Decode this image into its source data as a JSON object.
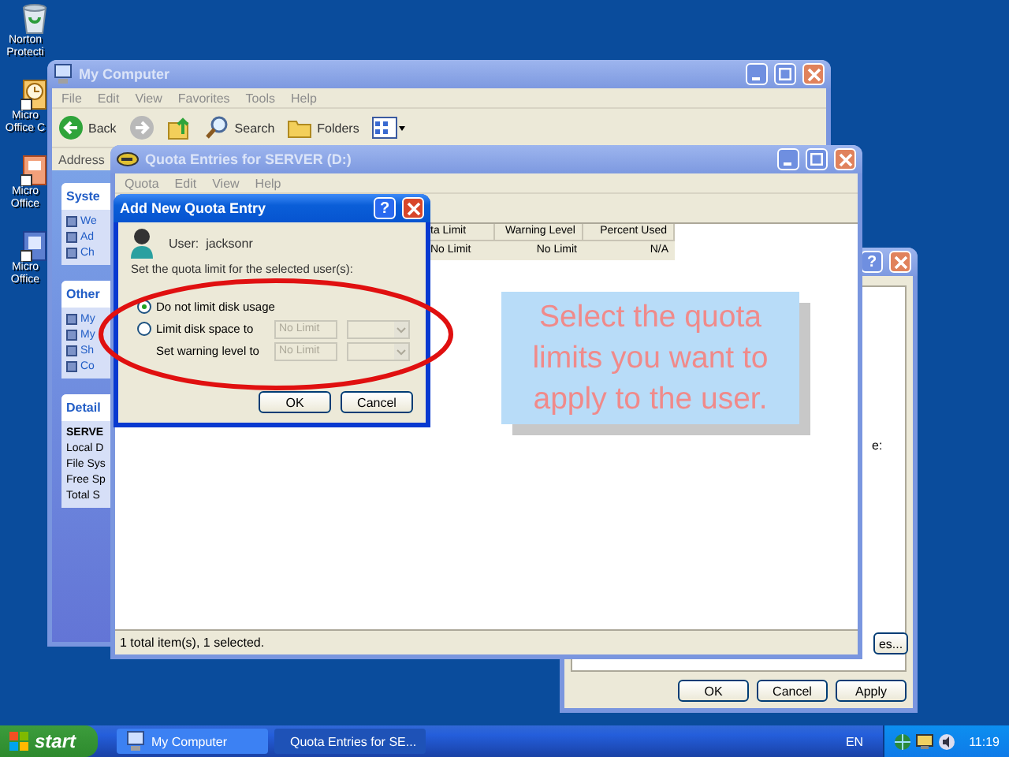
{
  "desktop_icons": [
    {
      "kind": "bin",
      "lines": [
        "Norton",
        "Protecti"
      ]
    },
    {
      "kind": "clock",
      "lines": [
        "Micro",
        "Office C"
      ]
    },
    {
      "kind": "slides",
      "lines": [
        "Micro",
        "Office"
      ]
    },
    {
      "kind": "doc",
      "lines": [
        "Micro",
        "Office"
      ]
    }
  ],
  "my_computer": {
    "title": "My Computer",
    "active": false,
    "menu": [
      "File",
      "Edit",
      "View",
      "Favorites",
      "Tools",
      "Help"
    ],
    "toolbar": [
      {
        "kind": "back",
        "label": "Back"
      },
      {
        "kind": "forward"
      },
      {
        "kind": "up"
      },
      {
        "kind": "search",
        "label": "Search"
      },
      {
        "kind": "folders",
        "label": "Folders"
      },
      {
        "kind": "views"
      }
    ],
    "address_label": "Address",
    "panels": [
      {
        "kind": "tasks",
        "title": "Syste",
        "items": [
          "We",
          "Ad",
          "Ch"
        ]
      },
      {
        "kind": "tasks",
        "title": "Other",
        "items": [
          "My",
          "My",
          "Sh",
          "Co"
        ]
      },
      {
        "kind": "details",
        "title": "Detail",
        "items": [
          "SERVE",
          "Local D",
          "File Sys",
          "Free Sp",
          "Total S"
        ]
      }
    ]
  },
  "properties": {
    "active": false,
    "help_button": "?",
    "label_fragment": "e:",
    "side_button": "es...",
    "buttons": [
      "OK",
      "Cancel",
      "Apply"
    ]
  },
  "quota_window": {
    "title": "Quota Entries for SERVER (D:)",
    "active": false,
    "menu": [
      "Quota",
      "Edit",
      "View",
      "Help"
    ],
    "columns": [
      "ta Limit",
      "Warning Level",
      "Percent Used"
    ],
    "rows": [
      {
        "cells": [
          "No Limit",
          "No Limit",
          "N/A"
        ],
        "selected": true
      }
    ],
    "status": "1 total item(s), 1 selected."
  },
  "dialog": {
    "title": "Add New Quota Entry",
    "active": true,
    "help_button": "?",
    "user_label": "User:",
    "user_name": "jacksonr",
    "prompt": "Set the quota limit for the selected user(s):",
    "options": [
      {
        "kind": "radio",
        "label": "Do not limit disk usage",
        "selected": true
      },
      {
        "kind": "radio",
        "label": "Limit disk space to",
        "selected": false,
        "field": {
          "value": "No Limit",
          "disabled": true
        }
      },
      {
        "kind": "plain",
        "label": "Set warning level to",
        "field": {
          "value": "No Limit",
          "disabled": true
        }
      }
    ],
    "buttons": [
      "OK",
      "Cancel"
    ]
  },
  "callout": {
    "text": "Select the quota limits you want to apply to the user."
  },
  "taskbar": {
    "start": "start",
    "tasks": [
      {
        "kind": "computer",
        "label": "My Computer",
        "selected": false
      },
      {
        "kind": "drive",
        "label": "Quota Entries for SE...",
        "selected": true
      }
    ],
    "language": "EN",
    "clock": "11:19"
  }
}
